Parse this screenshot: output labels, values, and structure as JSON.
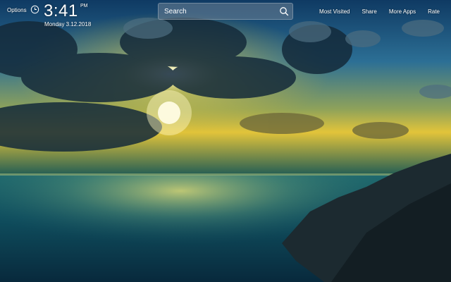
{
  "header": {
    "options_label": "Options",
    "clock_icon": "clock-icon",
    "time": "3:41",
    "ampm": "PM",
    "date": "Monday  3.12.2018"
  },
  "search": {
    "placeholder": "Search",
    "icon": "search-icon"
  },
  "nav": {
    "items": [
      {
        "label": "Most Visited"
      },
      {
        "label": "Share"
      },
      {
        "label": "More Apps"
      },
      {
        "label": "Rate"
      }
    ]
  },
  "colors": {
    "text": "#ffffff",
    "sky_top": "#0f3f66",
    "sun": "#fff6c2",
    "sea": "#0e4a5a"
  }
}
